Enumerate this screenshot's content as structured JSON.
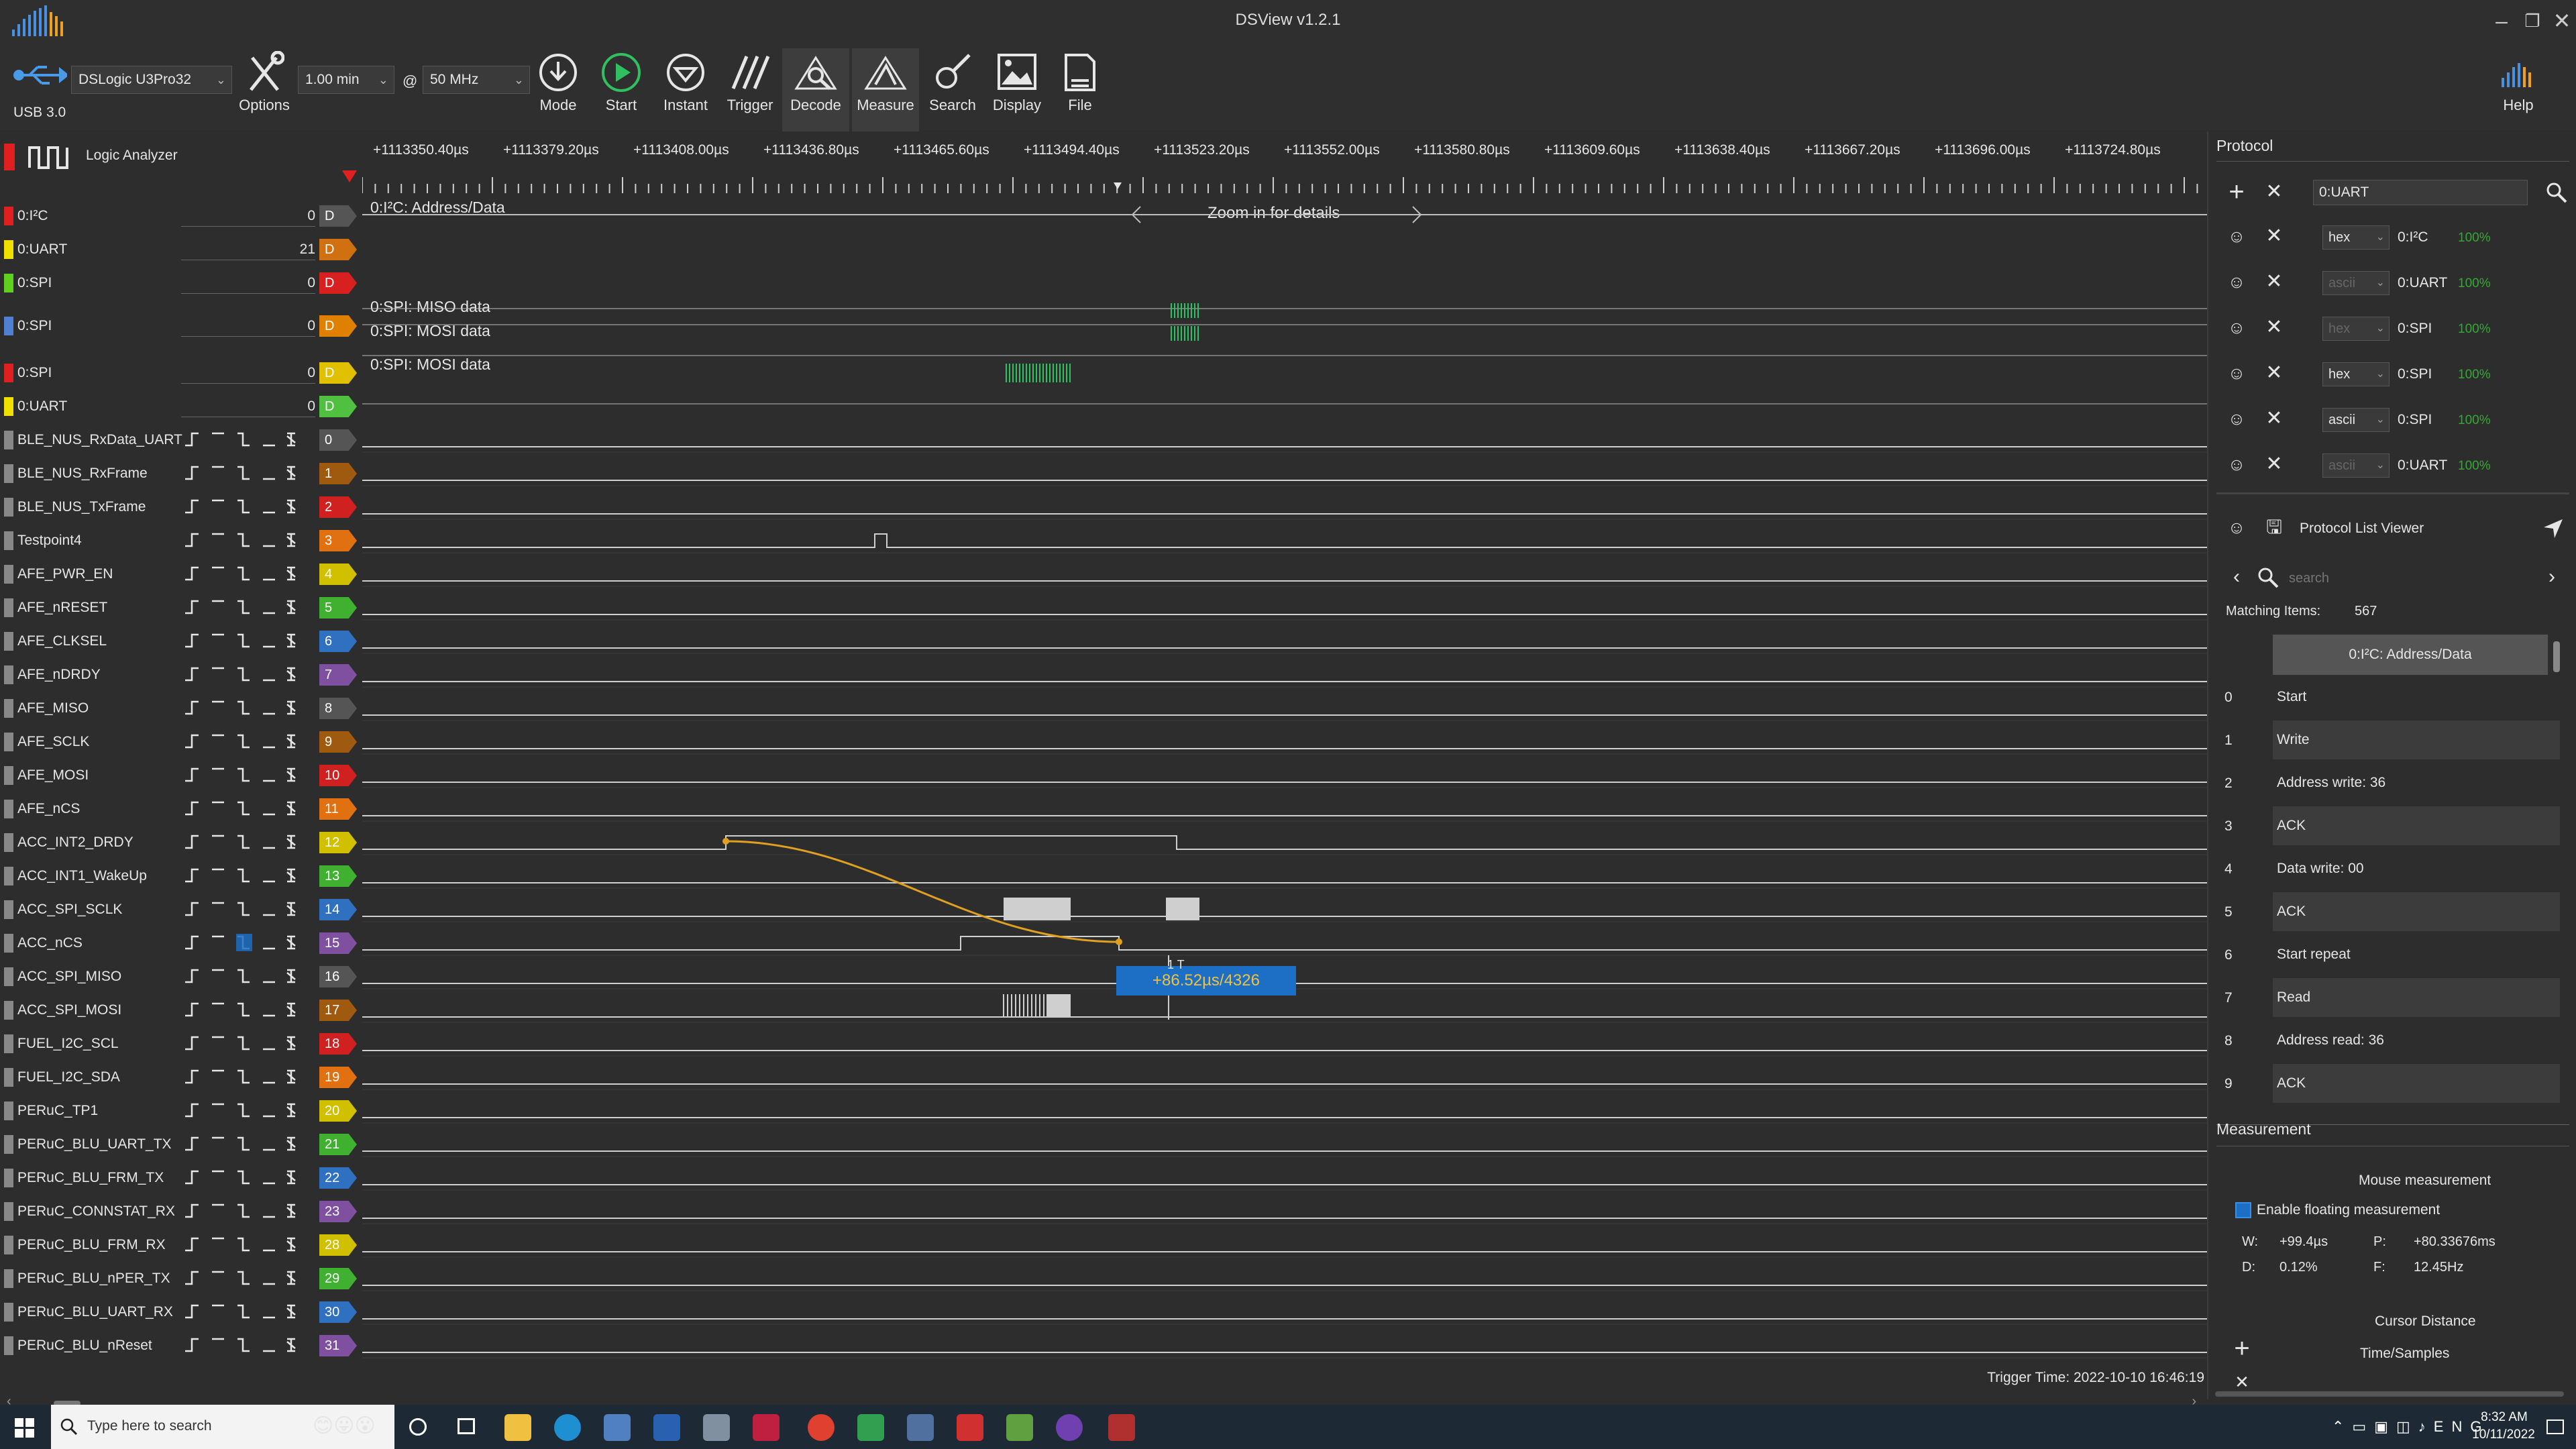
{
  "window": {
    "title": "DSView v1.2.1"
  },
  "toolbar": {
    "usb_label": "USB 3.0",
    "device": "DSLogic U3Pro32",
    "options_label": "Options",
    "duration": "1.00 min",
    "at": "@",
    "rate": "50 MHz",
    "buttons": [
      "Mode",
      "Start",
      "Instant",
      "Trigger",
      "Decode",
      "Measure",
      "Search",
      "Display",
      "File"
    ],
    "help_label": "Help"
  },
  "ruler": {
    "ticks": [
      "+1113350.40µs",
      "+1113379.20µs",
      "+1113408.00µs",
      "+1113436.80µs",
      "+1113465.60µs",
      "+1113494.40µs",
      "+1113523.20µs",
      "+1113552.00µs",
      "+1113580.80µs",
      "+1113609.60µs",
      "+1113638.40µs",
      "+1113667.20µs",
      "+1113696.00µs",
      "+1113724.80µs"
    ]
  },
  "header": {
    "label": "Logic Analyzer"
  },
  "decoders": [
    {
      "name": "0:I²C",
      "value": "0",
      "tag": "D",
      "color": "#e02020",
      "tagcolor": "#555555"
    },
    {
      "name": "0:UART",
      "value": "21",
      "tag": "D",
      "color": "#f0e000",
      "tagcolor": "#d07010"
    },
    {
      "name": "0:SPI",
      "value": "0",
      "tag": "D",
      "color": "#60d020",
      "tagcolor": "#d82020"
    },
    {
      "name": "0:SPI",
      "value": "0",
      "tag": "D",
      "color": "#5080d0",
      "tagcolor": "#e08000"
    },
    {
      "name": "0:SPI",
      "value": "0",
      "tag": "D",
      "color": "#e02020",
      "tagcolor": "#e0c000"
    },
    {
      "name": "0:UART",
      "value": "0",
      "tag": "D",
      "color": "#f0e000",
      "tagcolor": "#50c040"
    }
  ],
  "decode_text": {
    "i2c": "0:I²C: Address/Data",
    "zoom": "Zoom in for details",
    "miso": "0:SPI: MISO data",
    "mosi1": "0:SPI: MOSI data",
    "mosi2": "0:SPI: MOSI data"
  },
  "channels": [
    {
      "name": "BLE_NUS_RxData_UART",
      "num": "0",
      "color": "#555555"
    },
    {
      "name": "BLE_NUS_RxFrame",
      "num": "1",
      "color": "#a05a10"
    },
    {
      "name": "BLE_NUS_TxFrame",
      "num": "2",
      "color": "#d02020"
    },
    {
      "name": "Testpoint4",
      "num": "3",
      "color": "#e07010"
    },
    {
      "name": "AFE_PWR_EN",
      "num": "4",
      "color": "#d0c000"
    },
    {
      "name": "AFE_nRESET",
      "num": "5",
      "color": "#40b030"
    },
    {
      "name": "AFE_CLKSEL",
      "num": "6",
      "color": "#3070c0"
    },
    {
      "name": "AFE_nDRDY",
      "num": "7",
      "color": "#8050a0"
    },
    {
      "name": "AFE_MISO",
      "num": "8",
      "color": "#555555"
    },
    {
      "name": "AFE_SCLK",
      "num": "9",
      "color": "#a05a10"
    },
    {
      "name": "AFE_MOSI",
      "num": "10",
      "color": "#d02020"
    },
    {
      "name": "AFE_nCS",
      "num": "11",
      "color": "#e07010"
    },
    {
      "name": "ACC_INT2_DRDY",
      "num": "12",
      "color": "#d0c000"
    },
    {
      "name": "ACC_INT1_WakeUp",
      "num": "13",
      "color": "#40b030"
    },
    {
      "name": "ACC_SPI_SCLK",
      "num": "14",
      "color": "#3070c0"
    },
    {
      "name": "ACC_nCS",
      "num": "15",
      "color": "#8050a0"
    },
    {
      "name": "ACC_SPI_MISO",
      "num": "16",
      "color": "#555555"
    },
    {
      "name": "ACC_SPI_MOSI",
      "num": "17",
      "color": "#a05a10"
    },
    {
      "name": "FUEL_I2C_SCL",
      "num": "18",
      "color": "#d02020"
    },
    {
      "name": "FUEL_I2C_SDA",
      "num": "19",
      "color": "#e07010"
    },
    {
      "name": "PERuC_TP1",
      "num": "20",
      "color": "#d0c000"
    },
    {
      "name": "PERuC_BLU_UART_TX",
      "num": "21",
      "color": "#40b030"
    },
    {
      "name": "PERuC_BLU_FRM_TX",
      "num": "22",
      "color": "#3070c0"
    },
    {
      "name": "PERuC_CONNSTAT_RX",
      "num": "23",
      "color": "#8050a0"
    },
    {
      "name": "PERuC_BLU_FRM_RX",
      "num": "28",
      "color": "#d0c000"
    },
    {
      "name": "PERuC_BLU_nPER_TX",
      "num": "29",
      "color": "#40b030"
    },
    {
      "name": "PERuC_BLU_UART_RX",
      "num": "30",
      "color": "#3070c0"
    },
    {
      "name": "PERuC_BLU_nReset",
      "num": "31",
      "color": "#8050a0"
    }
  ],
  "cursor_label": "+86.52µs/4326",
  "cursor_small": "1 T",
  "trigger_time": "Trigger Time: 2022-10-10 16:46:19",
  "protocol": {
    "title": "Protocol",
    "selected": "0:UART",
    "rows": [
      {
        "fmt": "hex",
        "fmt_enabled": true,
        "name": "0:I²C",
        "pct": "100%"
      },
      {
        "fmt": "ascii",
        "fmt_enabled": false,
        "name": "0:UART",
        "pct": "100%"
      },
      {
        "fmt": "hex",
        "fmt_enabled": false,
        "name": "0:SPI",
        "pct": "100%"
      },
      {
        "fmt": "hex",
        "fmt_enabled": true,
        "name": "0:SPI",
        "pct": "100%"
      },
      {
        "fmt": "ascii",
        "fmt_enabled": true,
        "name": "0:SPI",
        "pct": "100%"
      },
      {
        "fmt": "ascii",
        "fmt_enabled": false,
        "name": "0:UART",
        "pct": "100%"
      }
    ],
    "list_viewer_label": "Protocol List Viewer",
    "search_placeholder": "search",
    "matching_label": "Matching Items:",
    "matching_count": "567",
    "list_header": "0:I²C: Address/Data",
    "items": [
      {
        "num": "0",
        "text": "Start"
      },
      {
        "num": "1",
        "text": "Write"
      },
      {
        "num": "2",
        "text": "Address write: 36"
      },
      {
        "num": "3",
        "text": "ACK"
      },
      {
        "num": "4",
        "text": "Data write: 00"
      },
      {
        "num": "5",
        "text": "ACK"
      },
      {
        "num": "6",
        "text": "Start repeat"
      },
      {
        "num": "7",
        "text": "Read"
      },
      {
        "num": "8",
        "text": "Address read: 36"
      },
      {
        "num": "9",
        "text": "ACK"
      }
    ]
  },
  "measurement": {
    "title": "Measurement",
    "mouse_title": "Mouse measurement",
    "enable_label": "Enable floating measurement",
    "w_label": "W:",
    "w_value": "+99.4µs",
    "p_label": "P:",
    "p_value": "+80.33676ms",
    "d_label": "D:",
    "d_value": "0.12%",
    "f_label": "F:",
    "f_value": "12.45Hz",
    "cursor_title": "Cursor Distance",
    "time_samples": "Time/Samples"
  },
  "taskbar": {
    "search_placeholder": "Type here to search",
    "time": "8:32 AM",
    "date": "10/11/2022"
  }
}
